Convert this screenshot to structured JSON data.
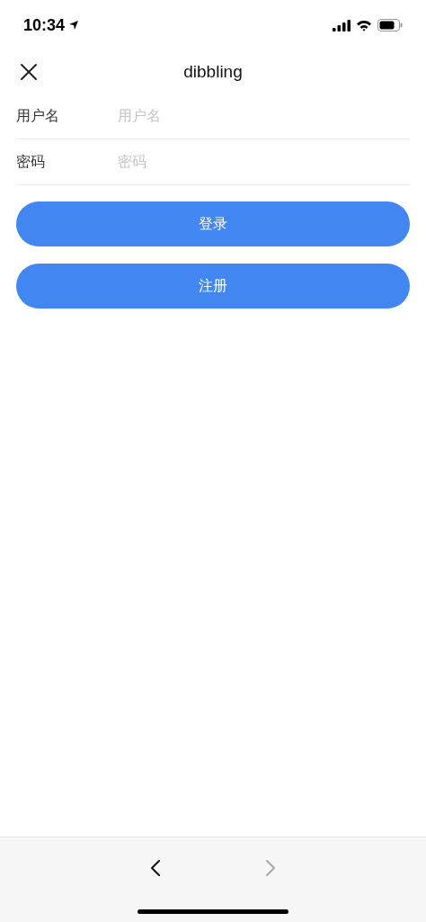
{
  "status_bar": {
    "time": "10:34"
  },
  "header": {
    "title": "dibbling"
  },
  "form": {
    "fields": [
      {
        "label": "用户名",
        "placeholder": "用户名"
      },
      {
        "label": "密码",
        "placeholder": "密码"
      }
    ]
  },
  "buttons": [
    "登录",
    "注册"
  ],
  "nav_bar": {
    "items": [
      {
        "kind": "back",
        "disabled": false
      },
      {
        "kind": "forward",
        "disabled": true
      }
    ]
  }
}
